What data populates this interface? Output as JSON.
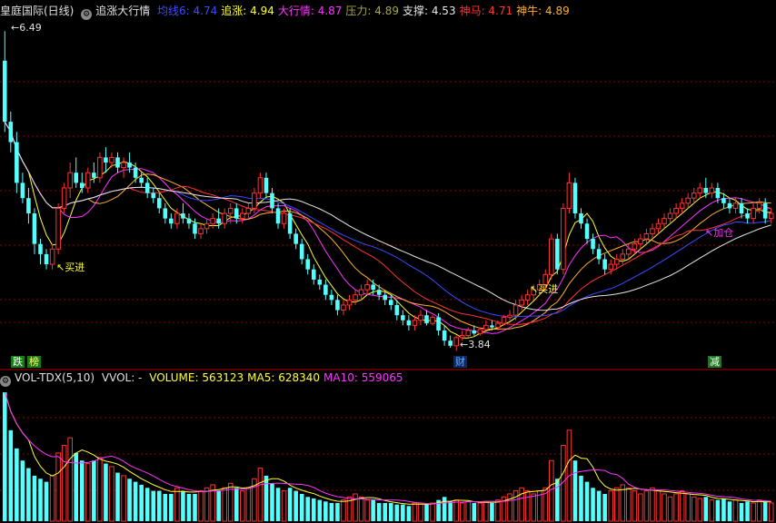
{
  "header": {
    "title": "皇庭国际(日线)",
    "indicator": "追涨大行情",
    "items": [
      {
        "label": "均线6:",
        "value": "4.74",
        "color": "#3b4bff"
      },
      {
        "label": "追涨:",
        "value": "4.94",
        "color": "#ffff33"
      },
      {
        "label": "大行情:",
        "value": "4.87",
        "color": "#ff33ff"
      },
      {
        "label": "压力:",
        "value": "4.89",
        "color": "#a8a840"
      },
      {
        "label": "支撑:",
        "value": "4.53",
        "color": "#e6e6e6"
      },
      {
        "label": "神马:",
        "value": "4.71",
        "color": "#ff3333"
      },
      {
        "label": "神牛:",
        "value": "4.89",
        "color": "#ffb030"
      }
    ]
  },
  "volume_header": {
    "indicator": "VOL-TDX(5,10)",
    "vvol": "VVOL: -",
    "items": [
      {
        "label": "VOLUME:",
        "value": "563123",
        "color": "#ffff33"
      },
      {
        "label": "MA5:",
        "value": "628340",
        "color": "#ffff33"
      },
      {
        "label": "MA10:",
        "value": "559065",
        "color": "#ff33ff"
      }
    ]
  },
  "annotations": {
    "high": "6.49",
    "low": "3.84",
    "buy1": "买进",
    "buy2": "买进",
    "add": "加仓"
  },
  "tags": [
    {
      "text": "跌",
      "bg": "#1a7a1a",
      "color": "#ffffff"
    },
    {
      "text": "榜",
      "bg": "#1a7a1a",
      "color": "#ffff66"
    },
    {
      "text": "财",
      "bg": "#0a2a66",
      "color": "#66aaff"
    },
    {
      "text": "减",
      "bg": "#1a7a1a",
      "color": "#ffffff"
    }
  ],
  "colors": {
    "up": "#ff3333",
    "down": "#54ffff",
    "grid": "#8b0000",
    "bg": "#000000"
  },
  "chart_data": {
    "type": "candlestick",
    "price_range": [
      3.3,
      6.6
    ],
    "candles": [
      [
        6.2,
        6.49,
        5.5,
        5.6
      ],
      [
        5.6,
        5.7,
        5.3,
        5.4
      ],
      [
        5.4,
        5.5,
        4.9,
        5.0
      ],
      [
        5.0,
        5.1,
        4.8,
        4.85
      ],
      [
        4.85,
        4.95,
        4.6,
        4.7
      ],
      [
        4.7,
        4.75,
        4.3,
        4.4
      ],
      [
        4.4,
        4.45,
        4.2,
        4.3
      ],
      [
        4.3,
        4.35,
        4.15,
        4.2
      ],
      [
        4.2,
        4.4,
        4.15,
        4.35
      ],
      [
        4.35,
        4.8,
        4.3,
        4.75
      ],
      [
        4.75,
        5.0,
        4.7,
        4.95
      ],
      [
        4.95,
        5.2,
        4.85,
        5.1
      ],
      [
        5.1,
        5.25,
        4.95,
        5.0
      ],
      [
        5.0,
        5.1,
        4.9,
        4.95
      ],
      [
        4.95,
        5.15,
        4.9,
        5.1
      ],
      [
        5.1,
        5.2,
        5.0,
        5.05
      ],
      [
        5.05,
        5.3,
        5.0,
        5.25
      ],
      [
        5.25,
        5.35,
        5.1,
        5.2
      ],
      [
        5.2,
        5.3,
        5.15,
        5.25
      ],
      [
        5.25,
        5.3,
        5.1,
        5.15
      ],
      [
        5.15,
        5.25,
        5.05,
        5.2
      ],
      [
        5.2,
        5.3,
        5.1,
        5.15
      ],
      [
        5.15,
        5.2,
        5.0,
        5.05
      ],
      [
        5.05,
        5.1,
        4.95,
        5.0
      ],
      [
        5.0,
        5.05,
        4.85,
        4.9
      ],
      [
        4.9,
        4.95,
        4.8,
        4.85
      ],
      [
        4.85,
        4.9,
        4.7,
        4.75
      ],
      [
        4.75,
        4.8,
        4.6,
        4.65
      ],
      [
        4.65,
        4.7,
        4.55,
        4.6
      ],
      [
        4.6,
        4.75,
        4.55,
        4.7
      ],
      [
        4.7,
        4.8,
        4.6,
        4.65
      ],
      [
        4.65,
        4.7,
        4.55,
        4.6
      ],
      [
        4.6,
        4.65,
        4.45,
        4.5
      ],
      [
        4.5,
        4.6,
        4.45,
        4.55
      ],
      [
        4.55,
        4.65,
        4.5,
        4.6
      ],
      [
        4.6,
        4.7,
        4.55,
        4.65
      ],
      [
        4.65,
        4.75,
        4.55,
        4.6
      ],
      [
        4.6,
        4.75,
        4.55,
        4.7
      ],
      [
        4.7,
        4.8,
        4.6,
        4.75
      ],
      [
        4.75,
        4.8,
        4.6,
        4.65
      ],
      [
        4.65,
        4.75,
        4.6,
        4.7
      ],
      [
        4.7,
        4.8,
        4.65,
        4.75
      ],
      [
        4.75,
        4.95,
        4.7,
        4.9
      ],
      [
        4.9,
        5.1,
        4.85,
        5.05
      ],
      [
        5.05,
        5.1,
        4.85,
        4.9
      ],
      [
        4.9,
        4.95,
        4.7,
        4.75
      ],
      [
        4.75,
        4.8,
        4.55,
        4.6
      ],
      [
        4.6,
        4.75,
        4.55,
        4.7
      ],
      [
        4.7,
        4.75,
        4.45,
        4.5
      ],
      [
        4.5,
        4.55,
        4.35,
        4.4
      ],
      [
        4.4,
        4.45,
        4.2,
        4.25
      ],
      [
        4.25,
        4.3,
        4.1,
        4.15
      ],
      [
        4.15,
        4.2,
        4.0,
        4.05
      ],
      [
        4.05,
        4.1,
        3.95,
        4.0
      ],
      [
        4.0,
        4.05,
        3.85,
        3.9
      ],
      [
        3.9,
        3.95,
        3.8,
        3.85
      ],
      [
        3.85,
        3.9,
        3.7,
        3.75
      ],
      [
        3.75,
        3.85,
        3.7,
        3.8
      ],
      [
        3.8,
        3.9,
        3.75,
        3.85
      ],
      [
        3.85,
        3.95,
        3.8,
        3.9
      ],
      [
        3.9,
        4.0,
        3.85,
        3.95
      ],
      [
        3.95,
        4.05,
        3.9,
        4.0
      ],
      [
        4.0,
        4.05,
        3.9,
        3.95
      ],
      [
        3.95,
        4.0,
        3.85,
        3.9
      ],
      [
        3.9,
        3.95,
        3.8,
        3.85
      ],
      [
        3.85,
        3.9,
        3.75,
        3.8
      ],
      [
        3.8,
        3.85,
        3.65,
        3.7
      ],
      [
        3.7,
        3.75,
        3.6,
        3.65
      ],
      [
        3.65,
        3.7,
        3.55,
        3.6
      ],
      [
        3.6,
        3.7,
        3.55,
        3.65
      ],
      [
        3.65,
        3.75,
        3.6,
        3.7
      ],
      [
        3.7,
        3.75,
        3.6,
        3.62
      ],
      [
        3.62,
        3.7,
        3.6,
        3.68
      ],
      [
        3.68,
        3.72,
        3.5,
        3.55
      ],
      [
        3.55,
        3.6,
        3.4,
        3.45
      ],
      [
        3.45,
        3.5,
        3.38,
        3.4
      ],
      [
        3.4,
        3.5,
        3.35,
        3.48
      ],
      [
        3.48,
        3.55,
        3.45,
        3.5
      ],
      [
        3.5,
        3.58,
        3.48,
        3.55
      ],
      [
        3.55,
        3.6,
        3.5,
        3.52
      ],
      [
        3.52,
        3.58,
        3.5,
        3.56
      ],
      [
        3.56,
        3.65,
        3.55,
        3.6
      ],
      [
        3.6,
        3.65,
        3.55,
        3.58
      ],
      [
        3.58,
        3.65,
        3.55,
        3.62
      ],
      [
        3.62,
        3.7,
        3.6,
        3.68
      ],
      [
        3.68,
        3.75,
        3.65,
        3.7
      ],
      [
        3.7,
        3.85,
        3.65,
        3.8
      ],
      [
        3.8,
        3.9,
        3.75,
        3.85
      ],
      [
        3.85,
        3.95,
        3.8,
        3.9
      ],
      [
        3.9,
        4.0,
        3.85,
        3.95
      ],
      [
        3.95,
        4.05,
        3.9,
        4.0
      ],
      [
        4.0,
        4.15,
        3.95,
        4.1
      ],
      [
        4.1,
        4.5,
        4.05,
        4.45
      ],
      [
        4.45,
        4.5,
        4.1,
        4.15
      ],
      [
        4.15,
        4.8,
        4.1,
        4.75
      ],
      [
        4.75,
        5.1,
        4.7,
        5.0
      ],
      [
        5.0,
        5.05,
        4.65,
        4.7
      ],
      [
        4.7,
        4.75,
        4.55,
        4.6
      ],
      [
        4.6,
        4.65,
        4.4,
        4.45
      ],
      [
        4.45,
        4.5,
        4.3,
        4.35
      ],
      [
        4.35,
        4.4,
        4.2,
        4.25
      ],
      [
        4.25,
        4.3,
        4.1,
        4.15
      ],
      [
        4.15,
        4.25,
        4.1,
        4.2
      ],
      [
        4.2,
        4.3,
        4.15,
        4.25
      ],
      [
        4.25,
        4.35,
        4.2,
        4.3
      ],
      [
        4.3,
        4.4,
        4.25,
        4.35
      ],
      [
        4.35,
        4.45,
        4.3,
        4.4
      ],
      [
        4.4,
        4.5,
        4.35,
        4.45
      ],
      [
        4.45,
        4.55,
        4.4,
        4.5
      ],
      [
        4.5,
        4.6,
        4.45,
        4.55
      ],
      [
        4.55,
        4.65,
        4.5,
        4.6
      ],
      [
        4.6,
        4.7,
        4.55,
        4.65
      ],
      [
        4.65,
        4.75,
        4.6,
        4.7
      ],
      [
        4.7,
        4.8,
        4.65,
        4.75
      ],
      [
        4.75,
        4.85,
        4.7,
        4.8
      ],
      [
        4.8,
        4.9,
        4.75,
        4.85
      ],
      [
        4.85,
        4.95,
        4.8,
        4.9
      ],
      [
        4.9,
        5.0,
        4.85,
        4.95
      ],
      [
        4.95,
        5.05,
        4.85,
        4.9
      ],
      [
        4.9,
        5.0,
        4.85,
        4.95
      ],
      [
        4.95,
        5.0,
        4.8,
        4.85
      ],
      [
        4.85,
        4.9,
        4.75,
        4.8
      ],
      [
        4.8,
        4.85,
        4.7,
        4.75
      ],
      [
        4.75,
        4.85,
        4.7,
        4.8
      ],
      [
        4.8,
        4.85,
        4.65,
        4.7
      ],
      [
        4.7,
        4.75,
        4.6,
        4.65
      ],
      [
        4.65,
        4.8,
        4.6,
        4.75
      ],
      [
        4.75,
        4.85,
        4.7,
        4.8
      ],
      [
        4.8,
        4.85,
        4.6,
        4.65
      ],
      [
        4.65,
        4.75,
        4.6,
        4.7
      ]
    ],
    "volume": [
      85,
      60,
      48,
      40,
      35,
      30,
      28,
      26,
      30,
      45,
      50,
      55,
      45,
      40,
      38,
      40,
      42,
      38,
      36,
      32,
      30,
      28,
      26,
      24,
      22,
      20,
      20,
      18,
      18,
      22,
      20,
      18,
      18,
      20,
      22,
      24,
      20,
      22,
      25,
      22,
      20,
      22,
      28,
      35,
      30,
      25,
      22,
      20,
      22,
      20,
      18,
      16,
      15,
      14,
      13,
      12,
      12,
      14,
      16,
      18,
      16,
      14,
      14,
      12,
      12,
      12,
      11,
      11,
      10,
      12,
      12,
      11,
      12,
      14,
      16,
      13,
      14,
      12,
      13,
      12,
      12,
      13,
      12,
      14,
      16,
      18,
      20,
      22,
      20,
      18,
      20,
      22,
      40,
      28,
      50,
      60,
      40,
      30,
      26,
      22,
      20,
      18,
      20,
      22,
      24,
      22,
      20,
      18,
      20,
      22,
      20,
      18,
      16,
      18,
      20,
      18,
      16,
      15,
      16,
      14,
      14,
      15,
      13,
      14,
      12,
      13,
      12,
      14,
      13,
      12
    ]
  }
}
